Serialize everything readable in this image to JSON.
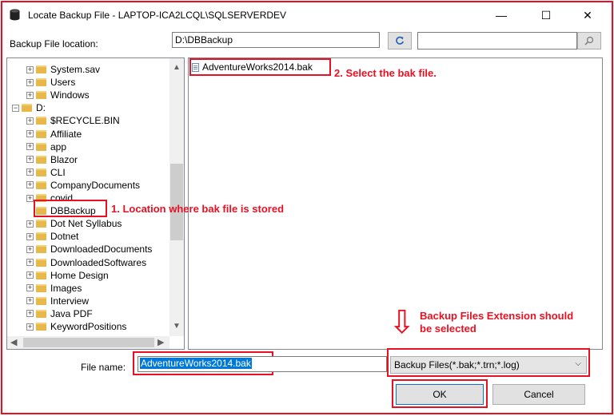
{
  "window": {
    "title": "Locate Backup File - LAPTOP-ICA2LCQL\\SQLSERVERDEV",
    "minimize_glyph": "—",
    "maximize_glyph": "☐",
    "close_glyph": "✕"
  },
  "location": {
    "label": "Backup File location:",
    "path": "D:\\DBBackup",
    "search_value": ""
  },
  "tree": [
    {
      "label": "System.sav",
      "level": 2,
      "expander": "+"
    },
    {
      "label": "Users",
      "level": 2,
      "expander": "+"
    },
    {
      "label": "Windows",
      "level": 2,
      "expander": "+"
    },
    {
      "label": "D:",
      "level": 1,
      "expander": "−"
    },
    {
      "label": "$RECYCLE.BIN",
      "level": 2,
      "expander": "+"
    },
    {
      "label": "Affiliate",
      "level": 2,
      "expander": "+"
    },
    {
      "label": "app",
      "level": 2,
      "expander": "+"
    },
    {
      "label": "Blazor",
      "level": 2,
      "expander": "+"
    },
    {
      "label": "CLI",
      "level": 2,
      "expander": "+"
    },
    {
      "label": "CompanyDocuments",
      "level": 2,
      "expander": "+"
    },
    {
      "label": "covid",
      "level": 2,
      "expander": "+"
    },
    {
      "label": "DBBackup",
      "level": 2,
      "expander": ""
    },
    {
      "label": "Dot Net Syllabus",
      "level": 2,
      "expander": "+"
    },
    {
      "label": "Dotnet",
      "level": 2,
      "expander": "+"
    },
    {
      "label": "DownloadedDocuments",
      "level": 2,
      "expander": "+"
    },
    {
      "label": "DownloadedSoftwares",
      "level": 2,
      "expander": "+"
    },
    {
      "label": "Home Design",
      "level": 2,
      "expander": "+"
    },
    {
      "label": "Images",
      "level": 2,
      "expander": "+"
    },
    {
      "label": "Interview",
      "level": 2,
      "expander": "+"
    },
    {
      "label": "Java PDF",
      "level": 2,
      "expander": "+"
    },
    {
      "label": "KeywordPositions",
      "level": 2,
      "expander": "+"
    }
  ],
  "files": [
    {
      "name": "AdventureWorks2014.bak"
    }
  ],
  "annotations": {
    "step1": "1. Location where bak file is stored",
    "step2": "2. Select the bak file.",
    "extension_line1": "Backup Files Extension should",
    "extension_line2": "be selected",
    "arrow_glyph": "⇩"
  },
  "bottom": {
    "filename_label": "File name:",
    "filename_value": "AdventureWorks2014.bak",
    "filter_value": "Backup Files(*.bak;*.trn;*.log)",
    "ok_label": "OK",
    "cancel_label": "Cancel"
  },
  "colors": {
    "annotation": "#e81123",
    "selection": "#0078d7",
    "folder": "#e8b94a"
  }
}
